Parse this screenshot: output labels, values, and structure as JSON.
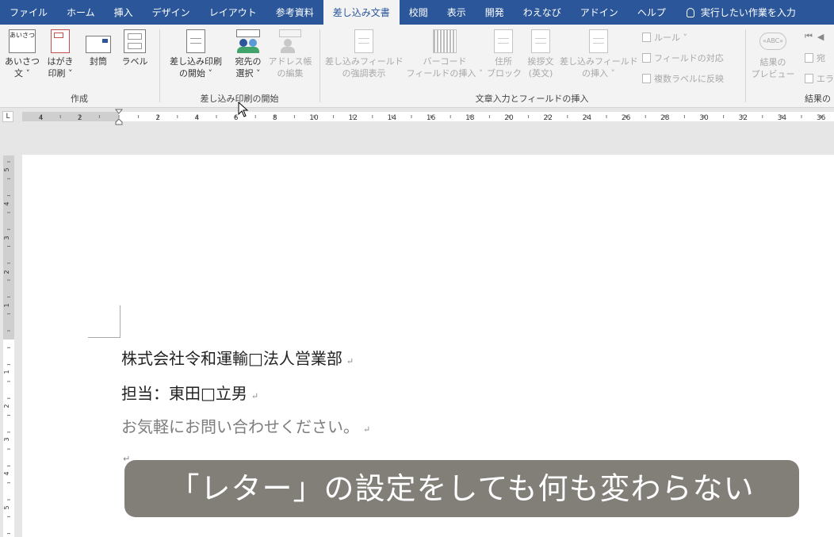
{
  "tabs": [
    "ファイル",
    "ホーム",
    "挿入",
    "デザイン",
    "レイアウト",
    "参考資料",
    "差し込み文書",
    "校閲",
    "表示",
    "開発",
    "わえなび",
    "アドイン",
    "ヘルプ"
  ],
  "active_tab_index": 6,
  "tell_me": "実行したい作業を入力",
  "colors": {
    "accent": "#2b579a",
    "ribbon_bg": "#f3f3f3",
    "caption_bg": "#78746e"
  },
  "groups": {
    "create": {
      "label": "作成",
      "greeting_icon_text": "あいさつ",
      "buttons": [
        {
          "l1": "あいさつ",
          "l2": "文 ˅",
          "icon": "greeting-text-icon"
        },
        {
          "l1": "はがき",
          "l2": "印刷 ˅",
          "icon": "postcard-icon"
        },
        {
          "l1": "封筒",
          "l2": "",
          "icon": "envelope-icon"
        },
        {
          "l1": "ラベル",
          "l2": "",
          "icon": "label-icon"
        }
      ]
    },
    "start": {
      "label": "差し込み印刷の開始",
      "buttons": [
        {
          "l1": "差し込み印刷",
          "l2": "の開始 ˅",
          "icon": "start-mail-merge-icon"
        },
        {
          "l1": "宛先の",
          "l2": "選択 ˅",
          "icon": "select-recipients-icon"
        },
        {
          "l1": "アドレス帳",
          "l2": "の編集",
          "icon": "edit-address-book-icon"
        }
      ]
    },
    "fields": {
      "label": "文章入力とフィールドの挿入",
      "buttons": [
        {
          "l1": "差し込みフィールド",
          "l2": "の強調表示",
          "icon": "highlight-fields-icon"
        },
        {
          "l1": "バーコード",
          "l2": "フィールドの挿入 ˅",
          "icon": "barcode-icon"
        },
        {
          "l1": "住所",
          "l2": "ブロック",
          "icon": "address-block-icon"
        },
        {
          "l1": "挨拶文",
          "l2": "(英文)",
          "icon": "greeting-line-icon"
        },
        {
          "l1": "差し込みフィールド",
          "l2": "の挿入 ˅",
          "icon": "insert-field-icon"
        }
      ],
      "small": [
        "ルール ˅",
        "フィールドの対応",
        "複数ラベルに反映"
      ]
    },
    "preview": {
      "label": "結果の",
      "button": {
        "l1": "結果の",
        "l2": "プレビュー",
        "icon_text": "«ABC»"
      },
      "small": [
        "宛",
        "エラ"
      ]
    }
  },
  "ruler": {
    "corner": "L",
    "labels": [
      "4",
      "2",
      "2",
      "4",
      "6",
      "8",
      "10",
      "12",
      "14",
      "16",
      "18",
      "20",
      "22",
      "24",
      "26",
      "28",
      "30",
      "32",
      "34",
      "36"
    ]
  },
  "vruler": {
    "labels": [
      "5",
      "4",
      "3",
      "2",
      "1",
      "1",
      "2",
      "3",
      "4",
      "5"
    ]
  },
  "document": {
    "lines": [
      {
        "text": "株式会社令和運輸□法人営業部",
        "mark": "↵"
      },
      {
        "text": "担当：東田□立男",
        "mark": "↵"
      },
      {
        "text": "お気軽にお問い合わせください。",
        "mark": "↵"
      }
    ],
    "empty_mark": "↵"
  },
  "caption": "「レター」の設定をしても何も変わらない"
}
